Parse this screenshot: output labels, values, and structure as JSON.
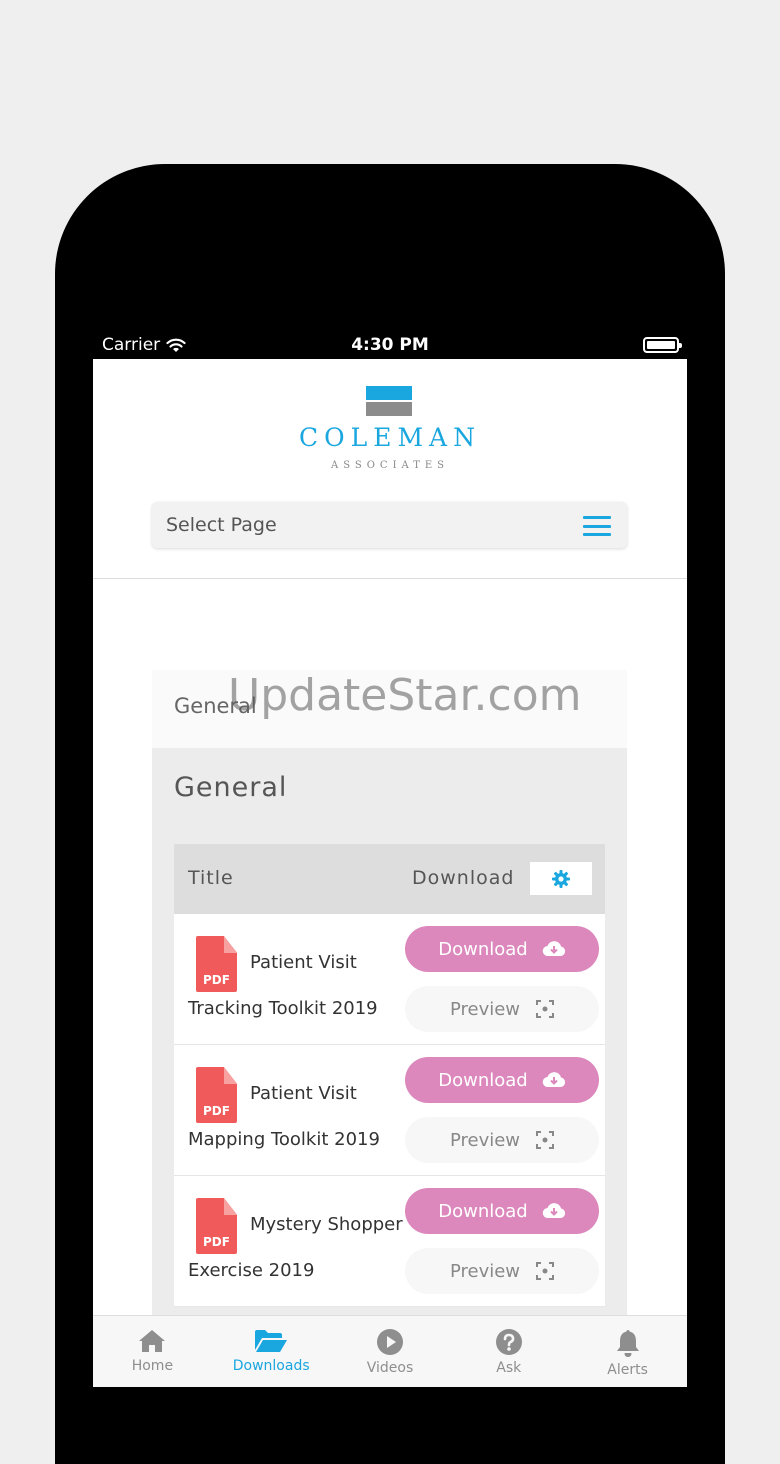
{
  "status": {
    "carrier": "Carrier",
    "time": "4:30 PM"
  },
  "brand": {
    "name": "COLEMAN",
    "sub": "ASSOCIATES",
    "color": "#1aa7e0"
  },
  "nav": {
    "select_label": "Select Page"
  },
  "section_header": "General",
  "watermark": "UpdateStar.com",
  "panel": {
    "title": "General"
  },
  "table": {
    "headers": {
      "title": "Title",
      "download": "Download"
    },
    "rows": [
      {
        "title_line1": "Patient Visit",
        "title_line2": "Tracking Toolkit 2019",
        "icon_text": "PDF",
        "download_label": "Download",
        "preview_label": "Preview"
      },
      {
        "title_line1": "Patient Visit",
        "title_line2": "Mapping Toolkit 2019",
        "icon_text": "PDF",
        "download_label": "Download",
        "preview_label": "Preview"
      },
      {
        "title_line1": "Mystery Shopper",
        "title_line2": "Exercise 2019",
        "icon_text": "PDF",
        "download_label": "Download",
        "preview_label": "Preview"
      }
    ]
  },
  "tabs": [
    {
      "label": "Home",
      "icon": "home-icon",
      "active": false
    },
    {
      "label": "Downloads",
      "icon": "folder-open-icon",
      "active": true
    },
    {
      "label": "Videos",
      "icon": "play-circle-icon",
      "active": false
    },
    {
      "label": "Ask",
      "icon": "question-circle-icon",
      "active": false
    },
    {
      "label": "Alerts",
      "icon": "bell-icon",
      "active": false
    }
  ],
  "colors": {
    "download_button": "#dc88bd",
    "pdf_icon": "#f05a5a",
    "accent": "#1aa7e0"
  }
}
